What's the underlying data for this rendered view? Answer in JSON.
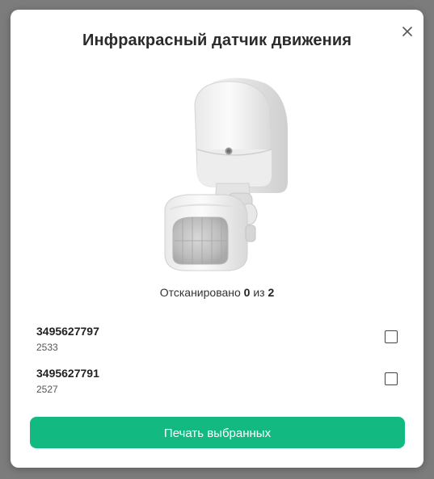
{
  "modal": {
    "title": "Инфракрасный датчик движения",
    "close_icon": "close-icon",
    "product_image": "motion-sensor-image"
  },
  "scan_status": {
    "prefix": "Отсканировано",
    "scanned": "0",
    "separator": "из",
    "total": "2"
  },
  "items": [
    {
      "code": "3495627797",
      "sub": "2533",
      "checked": false
    },
    {
      "code": "3495627791",
      "sub": "2527",
      "checked": false
    }
  ],
  "print_button": {
    "label": "Печать выбранных",
    "color": "#12b981"
  }
}
